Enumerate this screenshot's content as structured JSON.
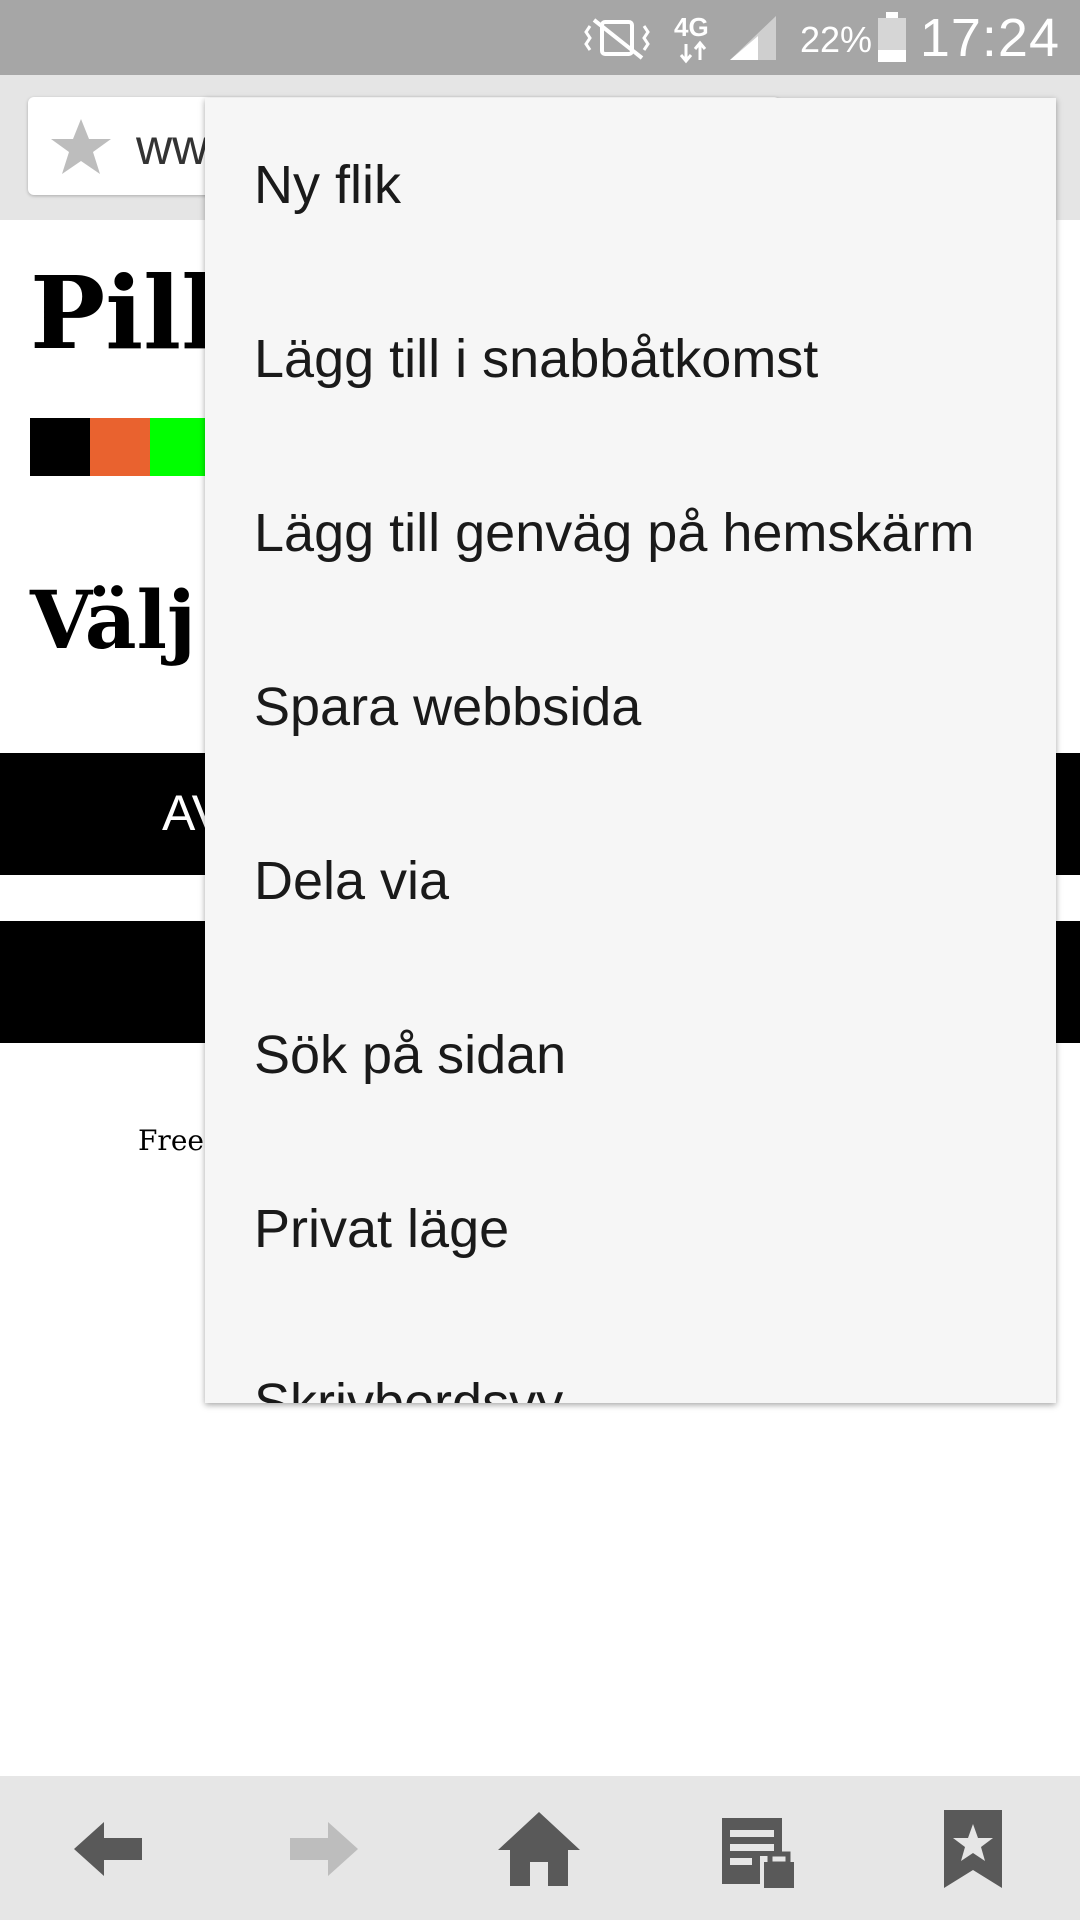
{
  "status_bar": {
    "time": "17:24",
    "battery": "22%",
    "network": "4G",
    "icons": [
      "vibrate-mute-icon",
      "network-4g-icon",
      "signal-icon",
      "battery-icon"
    ]
  },
  "url_bar": {
    "url": "www",
    "icon": "star-icon"
  },
  "page": {
    "title": "Pille",
    "subtitle": "Välj",
    "button_1_label": "AV",
    "small_text": "Free",
    "color_swatches": [
      "#000000",
      "#e9622f",
      "#00ff00"
    ]
  },
  "menu": {
    "items": [
      {
        "label": "Ny flik"
      },
      {
        "label": "Lägg till i snabbåtkomst"
      },
      {
        "label": "Lägg till genväg på hemskärm"
      },
      {
        "label": "Spara webbsida"
      },
      {
        "label": "Dela via"
      },
      {
        "label": "Sök på sidan"
      },
      {
        "label": "Privat läge"
      },
      {
        "label": "Skrivbordsvy"
      }
    ]
  },
  "toolbar": {
    "buttons": [
      "back-icon",
      "forward-icon",
      "home-icon",
      "saved-pages-icon",
      "bookmarks-icon"
    ]
  },
  "colors": {
    "status_bar": "#a6a6a6",
    "menu_bg": "#f6f6f6",
    "toolbar_bg": "#e6e6e6",
    "icon_active": "#595959",
    "icon_disabled": "#bdbdbd"
  }
}
